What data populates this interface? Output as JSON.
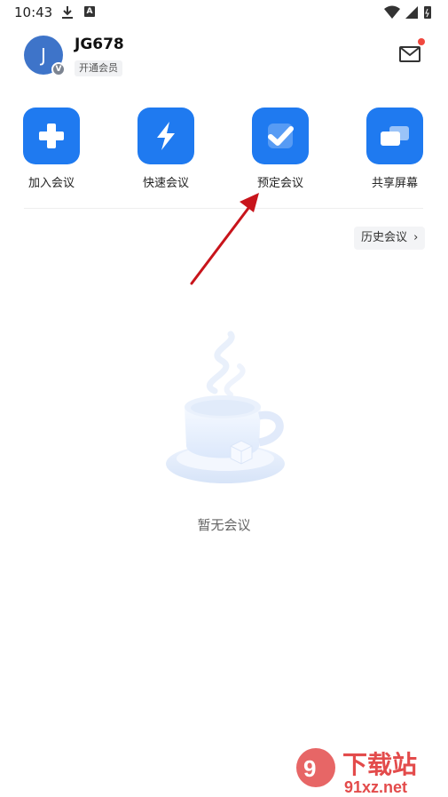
{
  "status_bar": {
    "time": "10:43",
    "notification_icon_letter": "A"
  },
  "profile": {
    "avatar_letter": "J",
    "avatar_badge": "V",
    "username": "JG678",
    "membership_label": "开通会员"
  },
  "mail": {
    "icon": "mail-icon",
    "has_unread_dot": true
  },
  "actions": [
    {
      "label": "加入会议",
      "icon": "plus-icon"
    },
    {
      "label": "快速会议",
      "icon": "lightning-icon"
    },
    {
      "label": "预定会议",
      "icon": "check-icon"
    },
    {
      "label": "共享屏幕",
      "icon": "screen-share-icon"
    }
  ],
  "history_button": {
    "label": "历史会议"
  },
  "empty_state": {
    "text": "暂无会议",
    "illustration": "coffee-cup-illustration"
  },
  "watermark": {
    "logo_text": "下载站",
    "site": "91xz.net"
  },
  "colors": {
    "accent": "#1f7af0",
    "avatar": "#3e74c9",
    "unread_dot": "#f0483e",
    "arrow": "#c8141b"
  }
}
